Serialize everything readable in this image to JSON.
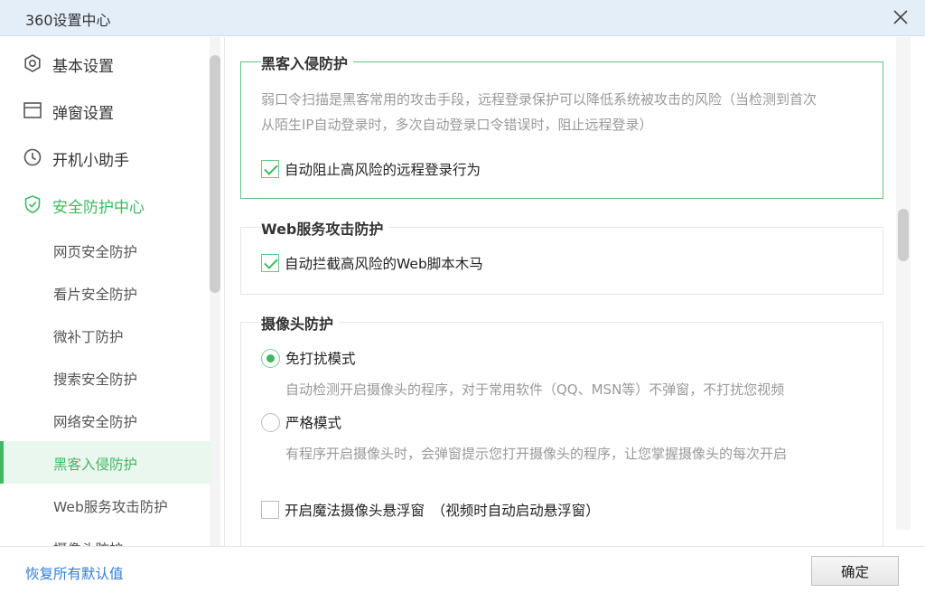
{
  "window": {
    "title": "360设置中心"
  },
  "sidebar": {
    "main_items": [
      {
        "label": "基本设置",
        "icon": "gear-icon"
      },
      {
        "label": "弹窗设置",
        "icon": "window-icon"
      },
      {
        "label": "开机小助手",
        "icon": "clock-icon"
      },
      {
        "label": "安全防护中心",
        "icon": "shield-icon"
      }
    ],
    "sub_items": [
      {
        "label": "网页安全防护"
      },
      {
        "label": "看片安全防护"
      },
      {
        "label": "微补丁防护"
      },
      {
        "label": "搜索安全防护"
      },
      {
        "label": "网络安全防护"
      },
      {
        "label": "黑客入侵防护"
      },
      {
        "label": "Web服务攻击防护"
      },
      {
        "label": "摄像头防护"
      }
    ]
  },
  "hacker": {
    "title": "黑客入侵防护",
    "desc_line1": "弱口令扫描是黑客常用的攻击手段，远程登录保护可以降低系统被攻击的风险（当检测到首次",
    "desc_line2": "从陌生IP自动登录时，多次自动登录口令错误时，阻止远程登录）",
    "option": "自动阻止高风险的远程登录行为"
  },
  "web": {
    "title": "Web服务攻击防护",
    "option": "自动拦截高风险的Web脚本木马"
  },
  "camera": {
    "title": "摄像头防护",
    "mode1_label": "免打扰模式",
    "mode1_desc": "自动检测开启摄像头的程序，对于常用软件（QQ、MSN等）不弹窗，不打扰您视频",
    "mode2_label": "严格模式",
    "mode2_desc": "有程序开启摄像头时，会弹窗提示您打开摄像头的程序，让您掌握摄像头的每次开启",
    "float_label": "开启魔法摄像头悬浮窗　（视频时自动启动悬浮窗）"
  },
  "footer": {
    "restore": "恢复所有默认值",
    "ok": "确定"
  },
  "colors": {
    "accent": "#3fb861",
    "link": "#2f7fd6",
    "titlebar": "#e4eef9"
  }
}
